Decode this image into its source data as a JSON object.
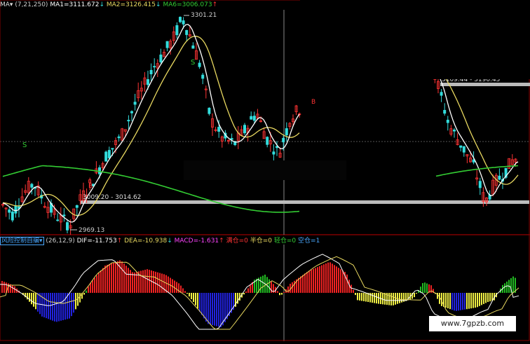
{
  "header": {
    "ma_selector": "MA▾",
    "ma_params": "(7,21,250)",
    "ma1": "MA1=3111.672",
    "ma1_arrow": "↓",
    "ma2": "MA2=3126.415",
    "ma2_arrow": "↓",
    "ma6": "MA6=3006.073",
    "ma6_arrow": "↑"
  },
  "indicator_header": {
    "name": "风险控制自编▾",
    "params": "(26,12,9)",
    "dif": "DIF=-11.753",
    "dif_arrow": "↑",
    "dea": "DEA=-10.938",
    "dea_arrow": "↓",
    "macd": "MACD=-1.631",
    "macd_arrow": "↑",
    "full": "满仓=0",
    "half": "半仓=0",
    "light": "轻仓=0",
    "empty": "空仓=1"
  },
  "watermark": "www.7gpzb.com",
  "colors": {
    "up": "#ff3333",
    "down": "#33dddd",
    "ma1": "#ffffff",
    "ma2": "#e8d860",
    "ma6": "#33cc33",
    "macd_pos": "#ee2222",
    "macd_pos_rising": "#22bb22",
    "macd_neg": "#eeee44",
    "macd_neg_deep": "#2222dd"
  },
  "chart_data": [
    {
      "type": "candlestick",
      "annotations": {
        "high_label": "3301.21",
        "low_label": "2969.13",
        "range_label": "3009.20 - 3014.62",
        "range_label_right": "3109.44 - 3190.45",
        "signals": [
          "S",
          "S",
          "B",
          "B"
        ]
      },
      "ma_series": [
        {
          "name": "MA1",
          "period": 7
        },
        {
          "name": "MA2",
          "period": 21
        },
        {
          "name": "MA6",
          "period": 250
        }
      ]
    },
    {
      "type": "bar",
      "title": "风险控制自编",
      "series": [
        {
          "name": "MACD"
        },
        {
          "name": "DIF"
        },
        {
          "name": "DEA"
        }
      ]
    }
  ]
}
